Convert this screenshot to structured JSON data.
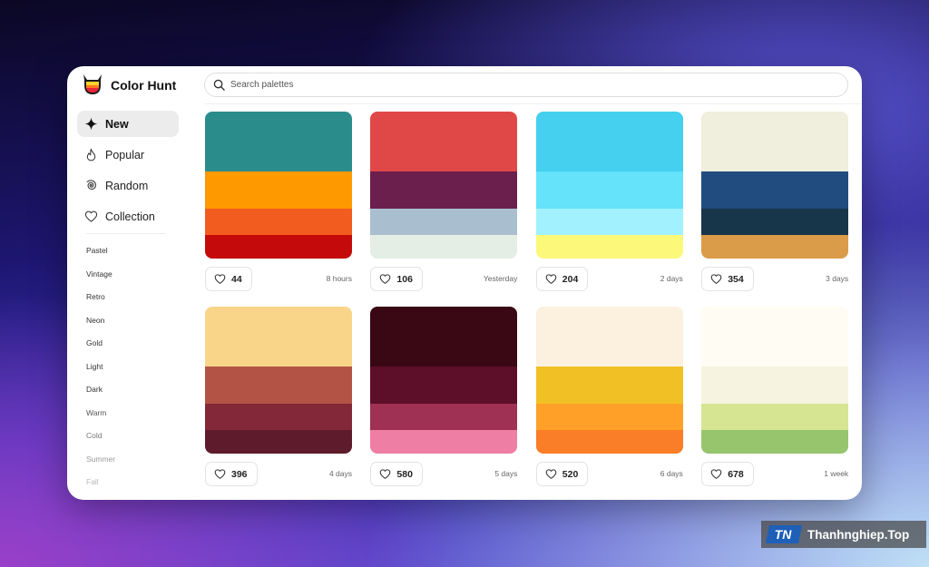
{
  "app": {
    "title": "Color Hunt"
  },
  "search": {
    "placeholder": "Search palettes"
  },
  "sidebar": {
    "nav": [
      {
        "label": "New",
        "icon": "sparkle-icon",
        "active": true
      },
      {
        "label": "Popular",
        "icon": "flame-icon",
        "active": false
      },
      {
        "label": "Random",
        "icon": "spiral-icon",
        "active": false
      },
      {
        "label": "Collection",
        "icon": "heart-icon",
        "active": false
      }
    ],
    "tags": [
      {
        "label": "Pastel",
        "color": "#333333"
      },
      {
        "label": "Vintage",
        "color": "#333333"
      },
      {
        "label": "Retro",
        "color": "#333333"
      },
      {
        "label": "Neon",
        "color": "#333333"
      },
      {
        "label": "Gold",
        "color": "#333333"
      },
      {
        "label": "Light",
        "color": "#333333"
      },
      {
        "label": "Dark",
        "color": "#333333"
      },
      {
        "label": "Warm",
        "color": "#555555"
      },
      {
        "label": "Cold",
        "color": "#777777"
      },
      {
        "label": "Summer",
        "color": "#9a9a9a"
      },
      {
        "label": "Fall",
        "color": "#b8b8b8"
      }
    ]
  },
  "palettes": [
    {
      "colors": [
        "#2B8C8C",
        "#FF9900",
        "#F25C1F",
        "#C40A0A"
      ],
      "likes": "44",
      "time": "8 hours"
    },
    {
      "colors": [
        "#E04848",
        "#6A1F4C",
        "#A9BECF",
        "#E4EEE4"
      ],
      "likes": "106",
      "time": "Yesterday"
    },
    {
      "colors": [
        "#44D0EE",
        "#64E3FA",
        "#A1F1FF",
        "#FCF87A"
      ],
      "likes": "204",
      "time": "2 days"
    },
    {
      "colors": [
        "#F0EEDC",
        "#214C80",
        "#17364A",
        "#DA9C48"
      ],
      "likes": "354",
      "time": "3 days"
    },
    {
      "colors": [
        "#F9D589",
        "#B35346",
        "#832838",
        "#5E1B2B"
      ],
      "likes": "396",
      "time": "4 days"
    },
    {
      "colors": [
        "#3A0715",
        "#5D0E29",
        "#9E3154",
        "#EE7EA4"
      ],
      "likes": "580",
      "time": "5 days"
    },
    {
      "colors": [
        "#FCF0DF",
        "#F0C025",
        "#FFA128",
        "#FA7D28"
      ],
      "likes": "520",
      "time": "6 days"
    },
    {
      "colors": [
        "#FFFCF3",
        "#F6F3E0",
        "#D6E592",
        "#96C56E"
      ],
      "likes": "678",
      "time": "1 week"
    }
  ],
  "watermark": {
    "text": "Thanhnghiep.Top",
    "logo_text": "TN"
  }
}
